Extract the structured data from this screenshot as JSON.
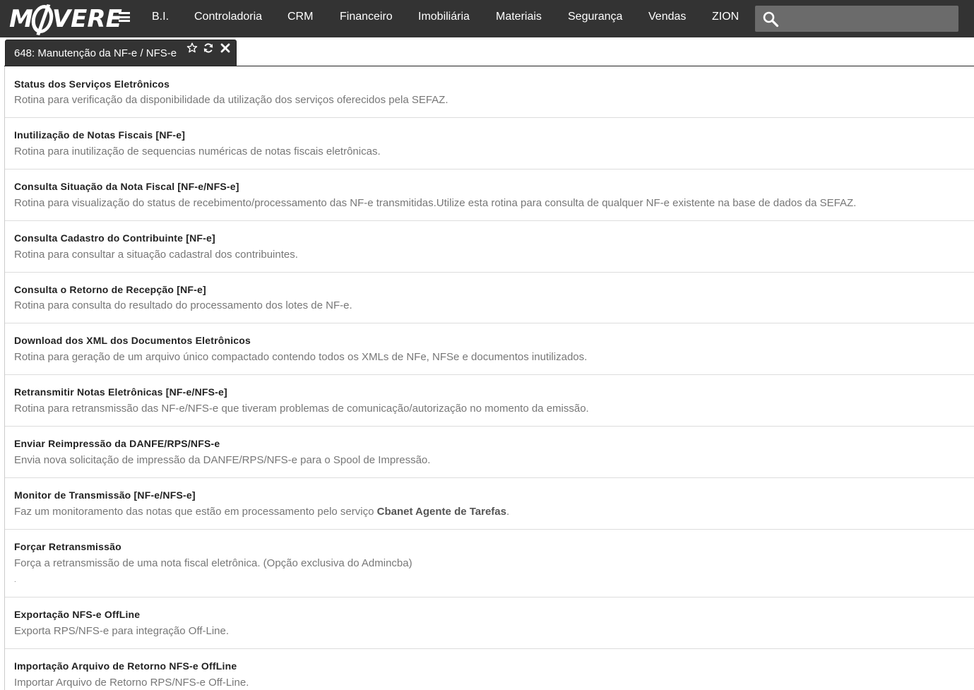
{
  "header": {
    "logo_text": "MOVERE",
    "menu": [
      {
        "label": "B.I."
      },
      {
        "label": "Controladoria"
      },
      {
        "label": "CRM"
      },
      {
        "label": "Financeiro"
      },
      {
        "label": "Imobiliária"
      },
      {
        "label": "Materiais"
      },
      {
        "label": "Segurança"
      },
      {
        "label": "Vendas"
      },
      {
        "label": "ZION"
      }
    ],
    "search": {
      "value": "",
      "placeholder": ""
    }
  },
  "tab": {
    "title": "648: Manutenção da NF-e / NFS-e",
    "icons": [
      "star-icon",
      "refresh-icon",
      "close-icon"
    ]
  },
  "items": [
    {
      "title": "Status dos Serviços Eletrônicos",
      "desc": "Rotina para verificação da disponibilidade da utilização dos serviços oferecidos pela SEFAZ."
    },
    {
      "title": "Inutilização de Notas Fiscais [NF-e]",
      "desc": "Rotina para inutilização de sequencias numéricas de notas fiscais eletrônicas."
    },
    {
      "title": "Consulta Situação da Nota Fiscal [NF-e/NFS-e]",
      "desc": "Rotina para visualização do status de recebimento/processamento das NF-e transmitidas.Utilize esta rotina para consulta de qualquer NF-e existente na base de dados da SEFAZ."
    },
    {
      "title": "Consulta Cadastro do Contribuinte [NF-e]",
      "desc": "Rotina para consultar a situação cadastral dos contribuintes."
    },
    {
      "title": "Consulta o Retorno de Recepção [NF-e]",
      "desc": "Rotina para consulta do resultado do processamento dos lotes de NF-e."
    },
    {
      "title": "Download dos XML dos Documentos Eletrônicos",
      "desc": "Rotina para geração de um arquivo único compactado contendo todos os XMLs de NFe, NFSe e documentos inutilizados."
    },
    {
      "title": "Retransmitir Notas Eletrônicas [NF-e/NFS-e]",
      "desc": "Rotina para retransmissão das NF-e/NFS-e que tiveram problemas de comunicação/autorização no momento da emissão."
    },
    {
      "title": "Enviar Reimpressão da DANFE/RPS/NFS-e",
      "desc": "Envia nova solicitação de impressão da DANFE/RPS/NFS-e para o Spool de Impressão."
    },
    {
      "title": "Monitor de Transmissão [NF-e/NFS-e]",
      "desc_pre": "Faz um monitoramento das notas que estão em processamento pelo serviço ",
      "desc_bold": "Cbanet Agente de Tarefas",
      "desc_post": "."
    },
    {
      "title": "Forçar Retransmissão",
      "desc": "Força a retransmissão de uma nota fiscal eletrônica. (Opção exclusiva do Admincba)",
      "extra": "."
    },
    {
      "title": "Exportação NFS-e OffLine",
      "desc": "Exporta RPS/NFS-e para integração Off-Line."
    },
    {
      "title": "Importação Arquivo de Retorno NFS-e OffLine",
      "desc": "Importar Arquivo de Retorno RPS/NFS-e Off-Line."
    }
  ]
}
